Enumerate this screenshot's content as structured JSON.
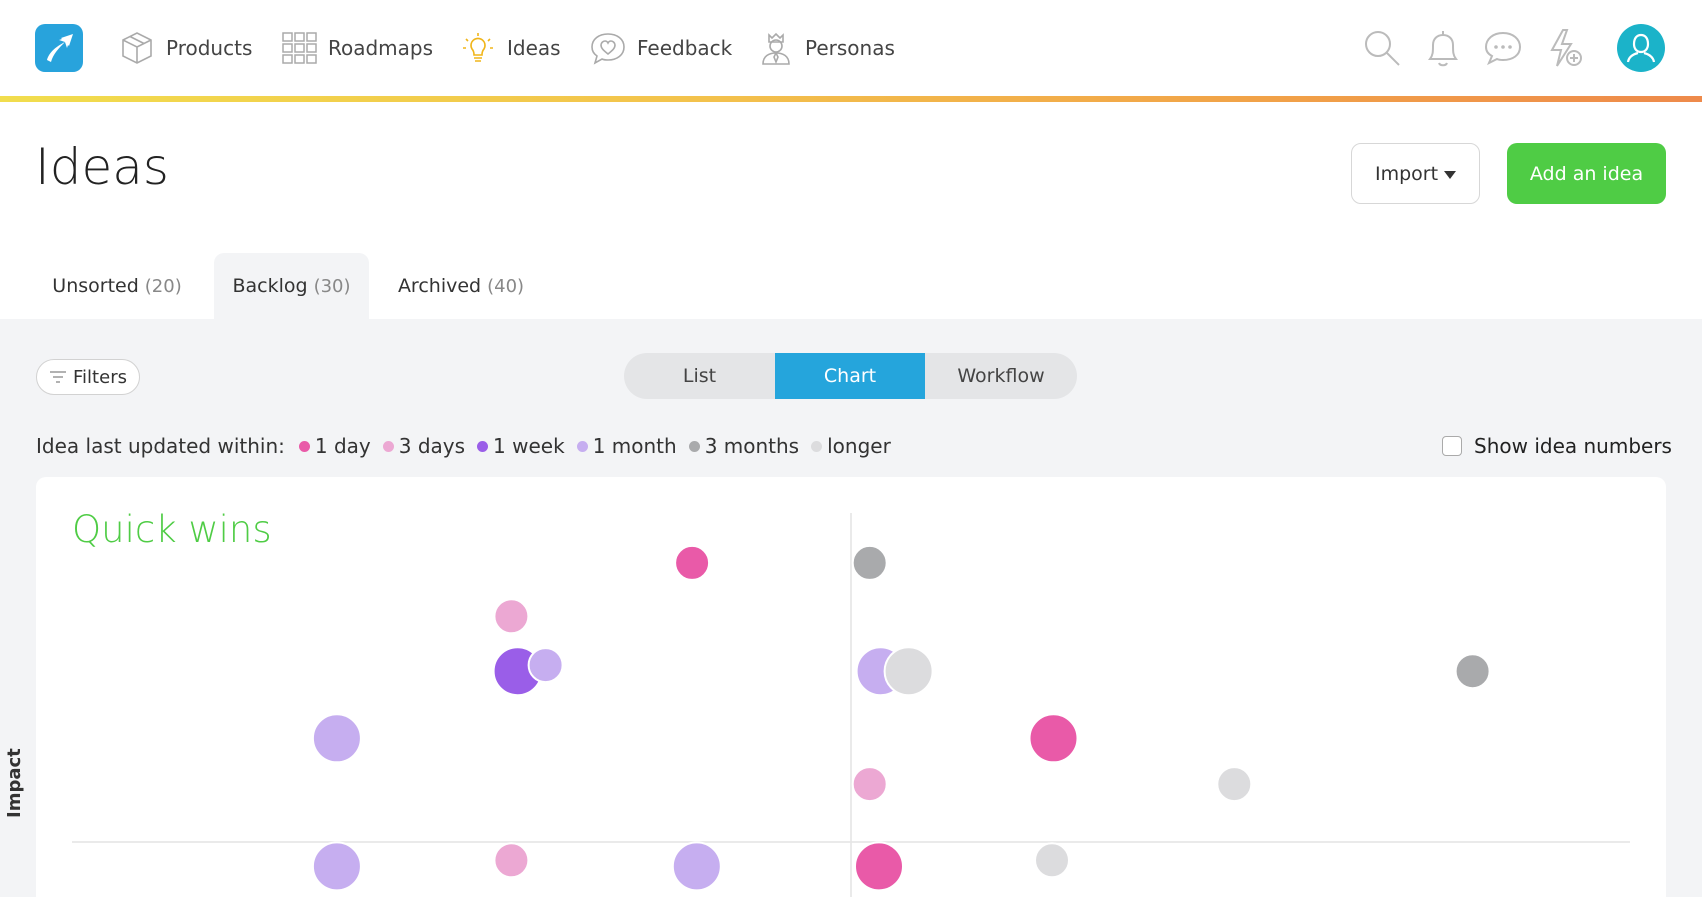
{
  "nav": {
    "items": [
      {
        "label": "Products",
        "icon": "box-icon"
      },
      {
        "label": "Roadmaps",
        "icon": "grid-icon"
      },
      {
        "label": "Ideas",
        "icon": "lightbulb-icon"
      },
      {
        "label": "Feedback",
        "icon": "heart-chat-icon"
      },
      {
        "label": "Personas",
        "icon": "persona-icon"
      }
    ],
    "right_icons": [
      "search-icon",
      "bell-icon",
      "chat-icon",
      "lightning-plus-icon"
    ],
    "accent_gradient": [
      "#f1dd4d",
      "#ee8a4b"
    ]
  },
  "header": {
    "title": "Ideas",
    "import_label": "Import",
    "add_label": "Add an idea"
  },
  "tabs": [
    {
      "label": "Unsorted",
      "count": "(20)"
    },
    {
      "label": "Backlog",
      "count": "(30)",
      "active": true
    },
    {
      "label": "Archived",
      "count": "(40)"
    }
  ],
  "toolbar": {
    "filters_label": "Filters",
    "views": [
      "List",
      "Chart",
      "Workflow"
    ],
    "active_view": "Chart"
  },
  "legend": {
    "lead": "Idea last updated within:",
    "items": [
      {
        "label": "1 day",
        "color": "#e95aa8"
      },
      {
        "label": "3 days",
        "color": "#eca8d3"
      },
      {
        "label": "1 week",
        "color": "#9a5ee8"
      },
      {
        "label": "1 month",
        "color": "#c6aef0"
      },
      {
        "label": "3 months",
        "color": "#a9aaac"
      },
      {
        "label": "longer",
        "color": "#dcdcde"
      }
    ]
  },
  "show_numbers_label": "Show idea numbers",
  "chart_data": {
    "type": "scatter",
    "quadrant_label": "Quick wins",
    "ylabel": "Impact",
    "points": [
      {
        "x": 0.398,
        "y": 0.915,
        "category": "1 day",
        "size": "m"
      },
      {
        "x": 0.512,
        "y": 0.915,
        "category": "3 months",
        "size": "m"
      },
      {
        "x": 0.282,
        "y": 0.74,
        "category": "3 days",
        "size": "m"
      },
      {
        "x": 0.286,
        "y": 0.56,
        "category": "1 week",
        "size": "l"
      },
      {
        "x": 0.304,
        "y": 0.58,
        "category": "1 month",
        "size": "m"
      },
      {
        "x": 0.519,
        "y": 0.56,
        "category": "1 month",
        "size": "l"
      },
      {
        "x": 0.537,
        "y": 0.56,
        "category": "longer",
        "size": "l"
      },
      {
        "x": 0.899,
        "y": 0.56,
        "category": "3 months",
        "size": "m"
      },
      {
        "x": 0.17,
        "y": 0.34,
        "category": "1 month",
        "size": "l"
      },
      {
        "x": 0.63,
        "y": 0.34,
        "category": "1 day",
        "size": "l"
      },
      {
        "x": 0.512,
        "y": 0.19,
        "category": "3 days",
        "size": "m"
      },
      {
        "x": 0.746,
        "y": 0.19,
        "category": "longer",
        "size": "m"
      },
      {
        "x": 0.17,
        "y": -0.08,
        "category": "1 month",
        "size": "l"
      },
      {
        "x": 0.282,
        "y": -0.06,
        "category": "3 days",
        "size": "m"
      },
      {
        "x": 0.401,
        "y": -0.08,
        "category": "1 month",
        "size": "l"
      },
      {
        "x": 0.518,
        "y": -0.08,
        "category": "1 day",
        "size": "l"
      },
      {
        "x": 0.629,
        "y": -0.06,
        "category": "longer",
        "size": "m"
      }
    ],
    "grid": false
  }
}
